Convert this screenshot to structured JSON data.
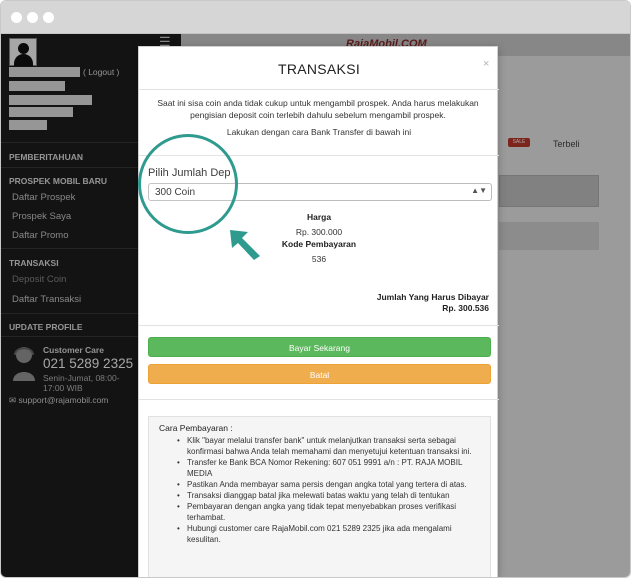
{
  "sidebar": {
    "logout_label": "( Logout )",
    "sections": {
      "pemberitahuan": "PEMBERITAHUAN",
      "prospek": "PROSPEK MOBIL BARU",
      "transaksi": "TRANSAKSI",
      "update_profile": "UPDATE PROFILE"
    },
    "prospek_items": [
      "Daftar Prospek",
      "Prospek Saya",
      "Daftar Promo"
    ],
    "transaksi_items": [
      "Deposit Coin",
      "Daftar Transaksi"
    ],
    "customer_care": {
      "label": "Customer Care",
      "phone": "021 5289 2325",
      "hours": "Senin-Jumat, 08:00-17:00 WIB"
    },
    "email": "support@rajamobil.com"
  },
  "background": {
    "logo": "RajaMobil.COM",
    "sale_badge": "SALE",
    "terbeli": "Terbeli"
  },
  "modal": {
    "title": "TRANSAKSI",
    "close": "×",
    "intro": "Saat ini sisa coin anda tidak cukup untuk mengambil prospek. Anda harus melakukan pengisian deposit coin terlebih dahulu sebelum mengambil prospek.",
    "intro2": "Lakukan dengan cara Bank Transfer di bawah ini",
    "pilih_label": "Pilih Jumlah Dep",
    "select_value": "300 Coin",
    "harga_label": "Harga",
    "harga_value": "Rp. 300.000",
    "kode_label": "Kode Pembayaran",
    "kode_value": "536",
    "jumlah_label": "Jumlah Yang Harus Dibayar",
    "jumlah_value": "Rp. 300.536",
    "bayar_button": "Bayar Sekarang",
    "batal_button": "Batal",
    "cara_title": "Cara Pembayaran :",
    "cara_items": [
      "Klik \"bayar melalui transfer bank\" untuk melanjutkan transaksi serta sebagai konfirmasi bahwa Anda telah memahami dan menyetujui ketentuan transaksi ini.",
      "Transfer ke Bank BCA Nomor Rekening: 607 051 9991 a/n : PT. RAJA MOBIL MEDIA",
      "Pastikan Anda membayar sama persis dengan angka total yang tertera di atas.",
      "Transaksi dianggap batal jika melewati batas waktu yang telah di tentukan",
      "Pembayaran dengan angka yang tidak tepat menyebabkan proses verifikasi terhambat.",
      "Hubungi customer care RajaMobil.com 021 5289 2325 jika ada mengalami kesulitan."
    ]
  },
  "colors": {
    "accent_green": "#5cb85c",
    "accent_orange": "#f0ad4e",
    "annotation": "#2f9a8e",
    "sidebar_bg": "#1e1e1e"
  }
}
